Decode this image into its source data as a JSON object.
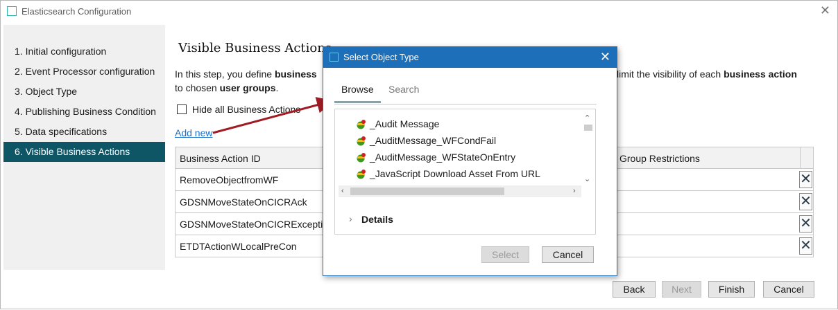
{
  "window": {
    "title": "Elasticsearch Configuration",
    "close_glyph": "✕"
  },
  "sidebar": {
    "steps": [
      {
        "label": "1. Initial configuration"
      },
      {
        "label": "2. Event Processor configuration"
      },
      {
        "label": "3. Object Type"
      },
      {
        "label": "4. Publishing Business Condition"
      },
      {
        "label": "5. Data specifications"
      },
      {
        "label": "6. Visible Business Actions"
      }
    ],
    "active_index": 5
  },
  "main": {
    "title": "Visible Business Actions",
    "description": {
      "line1_start": "In this step, you define ",
      "line1_bold1": "business",
      "line1_end": " limit the visibility of each ",
      "line1_bold2": "business action",
      "line2_start": "to chosen ",
      "line2_bold": "user groups",
      "line2_end": "."
    },
    "hide_all_label": "Hide all Business Actions",
    "add_new_label": "Add new",
    "table": {
      "col1_header": "Business Action ID",
      "col2_header": "Group Restrictions",
      "rows": [
        "RemoveObjectfromWF",
        "GDSNMoveStateOnCICRAck",
        "GDSNMoveStateOnCICRExceptio",
        "ETDTActionWLocalPreCon"
      ],
      "delete_glyph": "✕"
    },
    "buttons": {
      "back": "Back",
      "next": "Next",
      "finish": "Finish",
      "cancel": "Cancel"
    }
  },
  "dialog": {
    "title": "Select Object Type",
    "close_glyph": "✕",
    "tabs": {
      "browse": "Browse",
      "search": "Search"
    },
    "tree_items": [
      "_Audit Message",
      "_AuditMessage_WFCondFail",
      "_AuditMessage_WFStateOnEntry",
      "_JavaScript Download Asset From URL"
    ],
    "details_label": "Details",
    "buttons": {
      "select": "Select",
      "cancel": "Cancel"
    }
  },
  "colors": {
    "active_step": "#0e5566",
    "dialog_title_bar": "#1c6fb8",
    "link": "#1a6fc9",
    "arrow": "#a01c24"
  },
  "icons": [
    "app-icon",
    "close-icon",
    "object-type-icon",
    "chevron-right-icon",
    "delete-icon",
    "checkbox"
  ]
}
